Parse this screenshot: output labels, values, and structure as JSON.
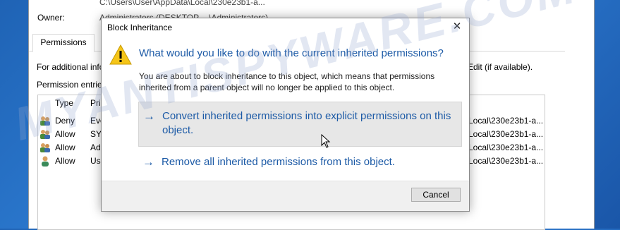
{
  "background_window": {
    "path_text": "C:\\Users\\User\\AppData\\Local\\230e23b1-a...",
    "owner_label": "Owner:",
    "owner_value": "Administrators (DESKTOP-...\\Administrators)",
    "tab_permissions": "Permissions",
    "info_text": "For additional info",
    "info_text_right": "Edit (if available).",
    "entries_label": "Permission entries:",
    "col_type": "Type",
    "col_principal": "Pri",
    "rows": [
      {
        "type": "Deny",
        "principal": "Eve",
        "inherited": "Local\\230e23b1-a..."
      },
      {
        "type": "Allow",
        "principal": "SYS",
        "inherited": "Local\\230e23b1-a..."
      },
      {
        "type": "Allow",
        "principal": "Ad",
        "inherited": "Local\\230e23b1-a..."
      },
      {
        "type": "Allow",
        "principal": "Use",
        "inherited": "Local\\230e23b1-a..."
      }
    ]
  },
  "watermark": "MYANTISPYWARE.COM",
  "dialog": {
    "title": "Block Inheritance",
    "close_glyph": "✕",
    "heading": "What would you like to do with the current inherited permissions?",
    "description": "You are about to block inheritance to this object, which means that permissions inherited from a parent object will no longer be applied to this object.",
    "option_convert": "Convert inherited permissions into explicit permissions on this object.",
    "option_remove": "Remove all inherited permissions from this object.",
    "arrow_glyph": "→",
    "cancel_label": "Cancel",
    "icon": "warning-icon",
    "accent_color": "#1c5aa6"
  }
}
